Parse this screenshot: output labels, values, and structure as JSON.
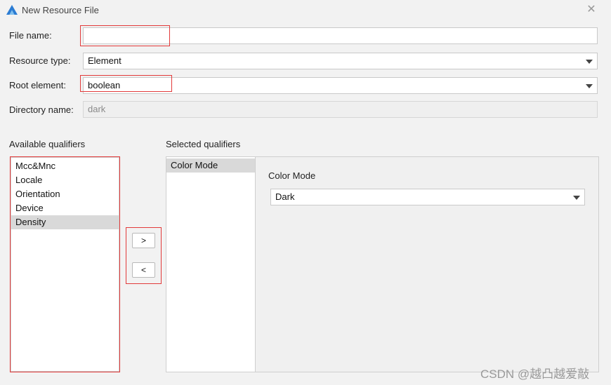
{
  "window": {
    "title": "New Resource File",
    "app_icon": "deveco-triangle-icon",
    "close_icon": "close-icon",
    "close_glyph": "✕"
  },
  "form": {
    "file_name": {
      "label": "File name:",
      "value": ""
    },
    "resource_type": {
      "label": "Resource type:",
      "value": "Element"
    },
    "root_element": {
      "label": "Root element:",
      "value": "boolean"
    },
    "directory_name": {
      "label": "Directory name:",
      "value": "dark"
    }
  },
  "qualifiers": {
    "available_title": "Available qualifiers",
    "available": [
      "Mcc&Mnc",
      "Locale",
      "Orientation",
      "Device",
      "Density"
    ],
    "available_selected": "Density",
    "selected_title": "Selected qualifiers",
    "selected": [
      "Color Mode"
    ],
    "selected_active": "Color Mode",
    "add_label": ">",
    "remove_label": "<"
  },
  "detail": {
    "title": "Color Mode",
    "value": "Dark"
  },
  "watermark": "CSDN @越凸越爱敲",
  "colors": {
    "highlight": "#e23a3a",
    "selection": "#d9d9d9",
    "icon_blue": "#2b7cd3"
  }
}
